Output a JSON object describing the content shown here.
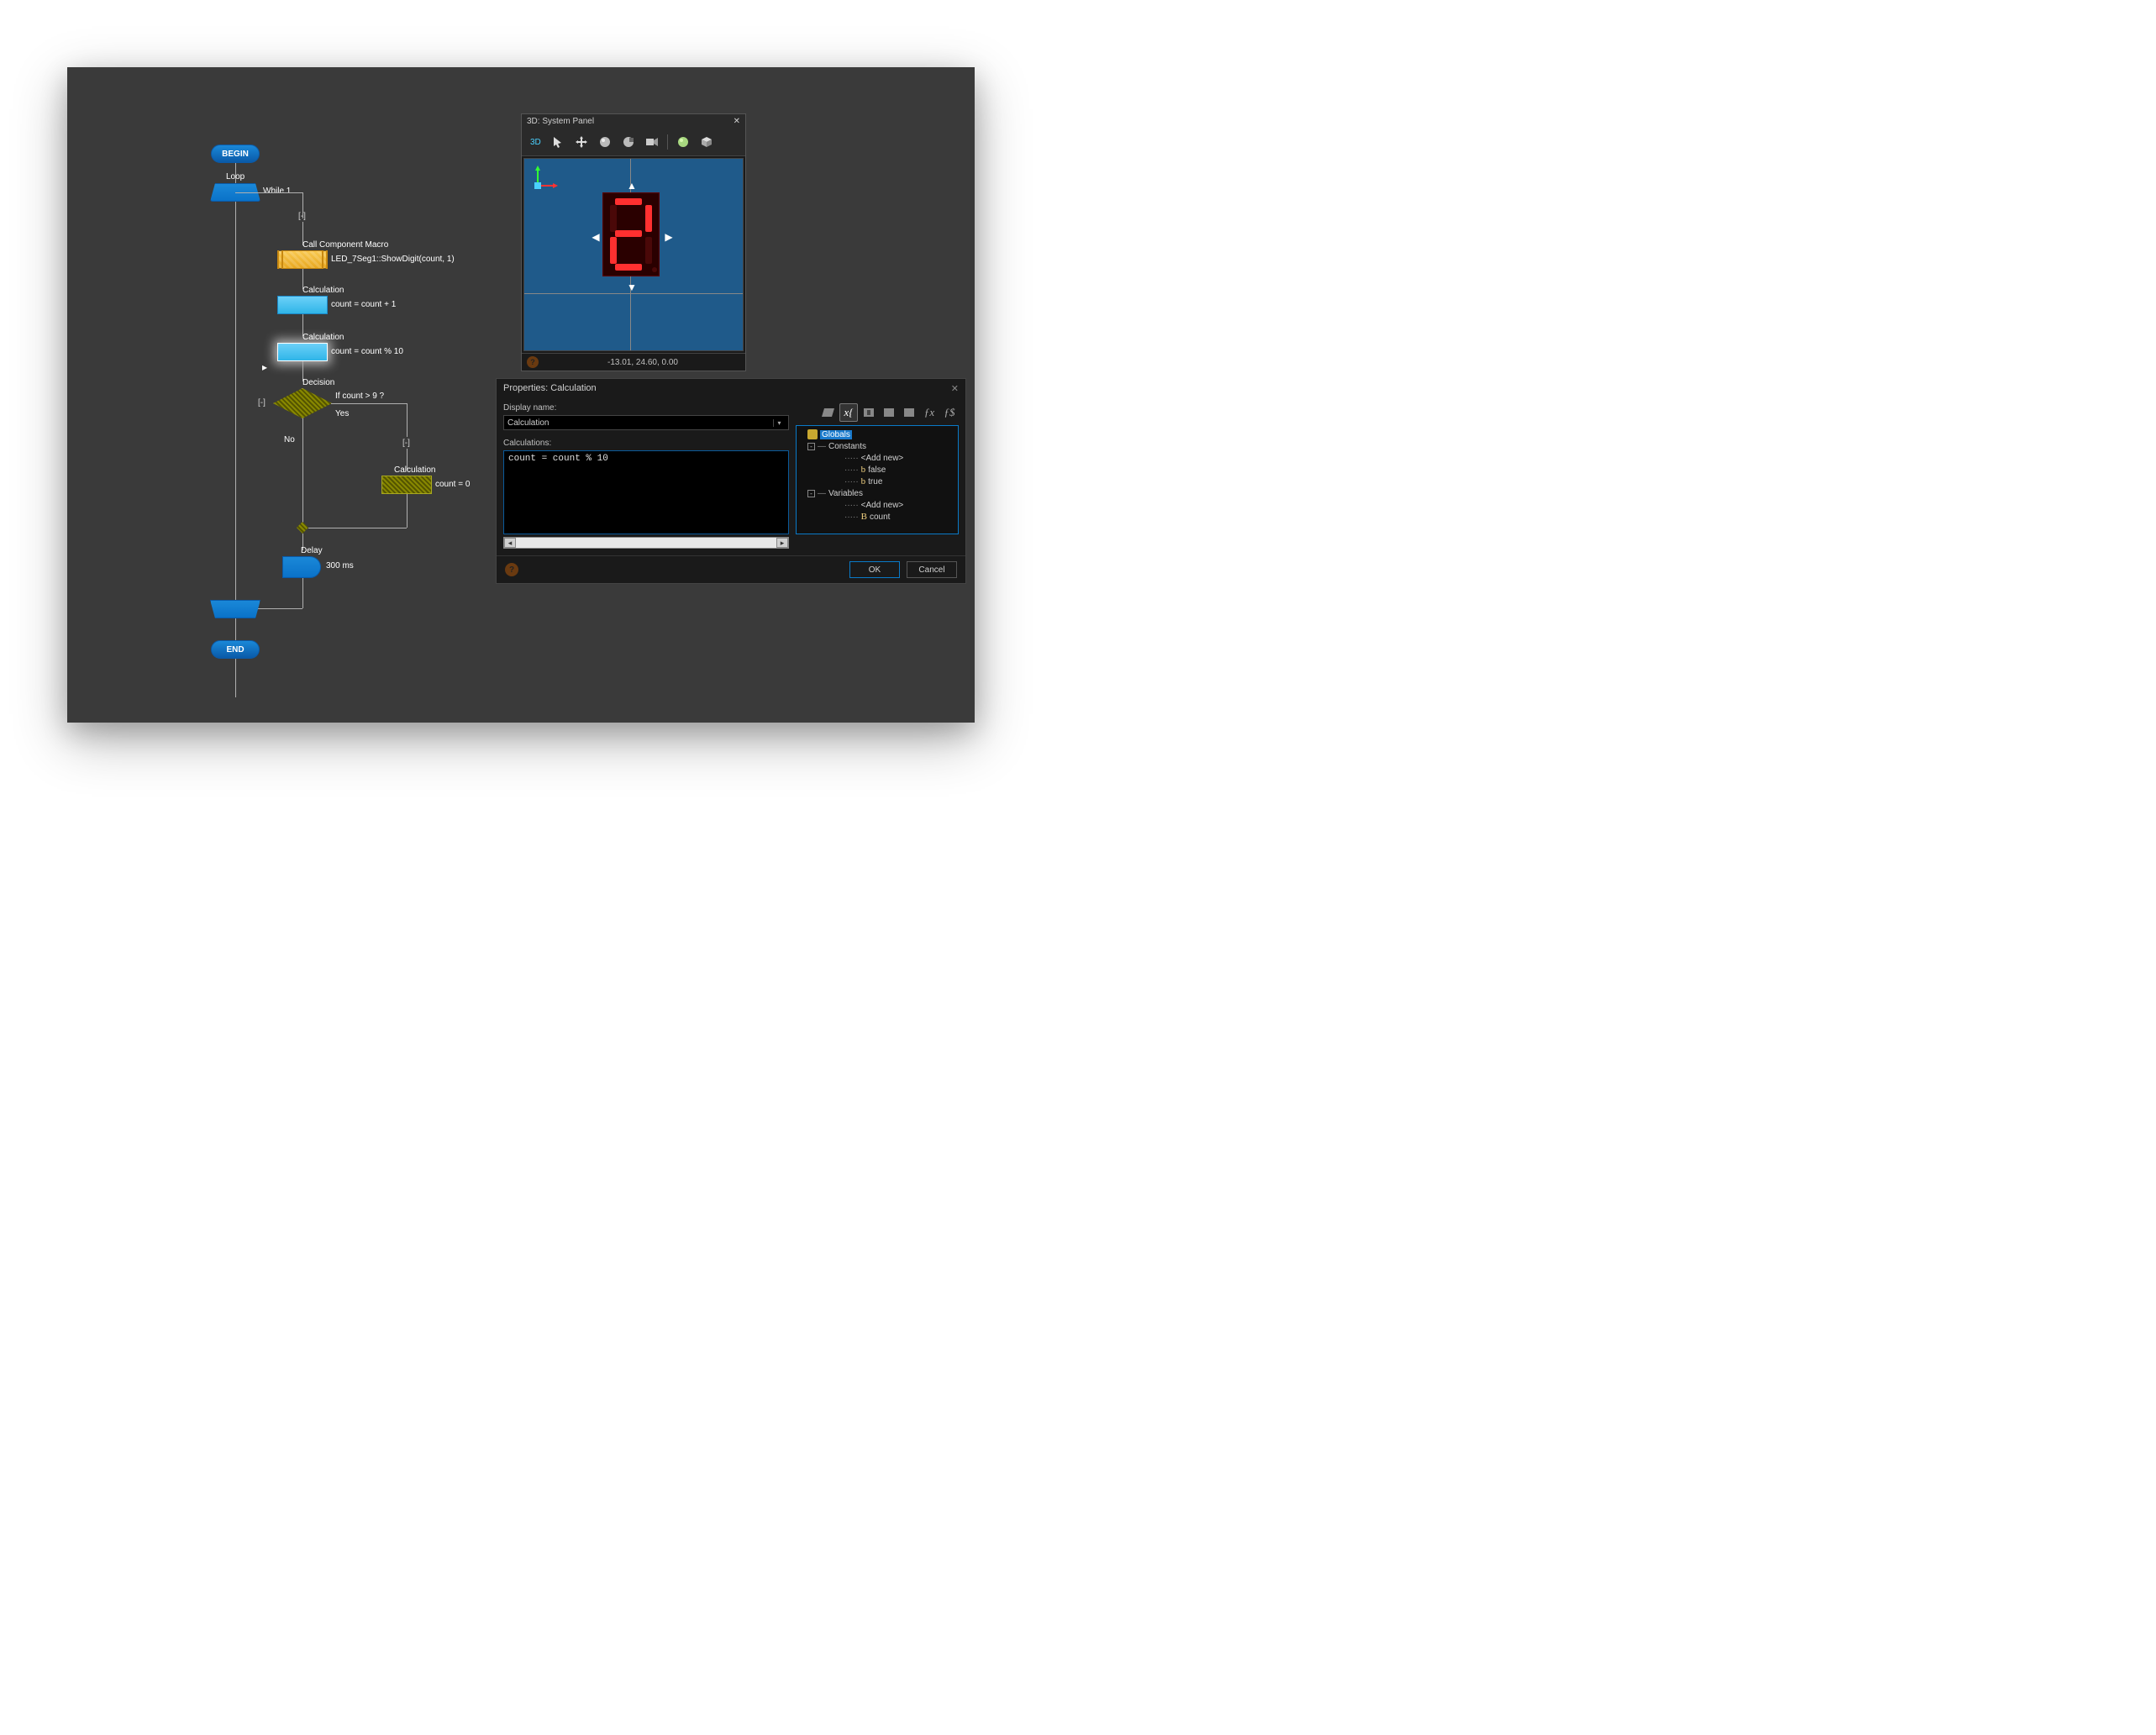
{
  "flowchart": {
    "begin": "BEGIN",
    "end": "END",
    "loop_label": "Loop",
    "while_cond": "While 1",
    "collapse_marker": "[-]",
    "macro_label": "Call Component Macro",
    "macro_text": "LED_7Seg1::ShowDigit(count, 1)",
    "calc1_label": "Calculation",
    "calc1_text": "count = count + 1",
    "calc2_label": "Calculation",
    "calc2_text": "count = count % 10",
    "decision_label": "Decision",
    "decision_cond": "If  count > 9 ?",
    "yes": "Yes",
    "no": "No",
    "calc3_label": "Calculation",
    "calc3_text": "count = 0",
    "delay_label": "Delay",
    "delay_text": "300 ms"
  },
  "panel3d": {
    "title": "3D: System Panel",
    "tab": "3D",
    "coords": "-13.01, 24.60, 0.00"
  },
  "props": {
    "title": "Properties: Calculation",
    "display_name_label": "Display name:",
    "display_name_value": "Calculation",
    "calculations_label": "Calculations:",
    "calculations_text": "count = count % 10",
    "fx1": "ƒx",
    "fx2": "ƒ$",
    "tree": {
      "globals": "Globals",
      "constants": "Constants",
      "add_new": "<Add new>",
      "false": "false",
      "true": "true",
      "variables": "Variables",
      "count": "count"
    },
    "ok": "OK",
    "cancel": "Cancel"
  }
}
